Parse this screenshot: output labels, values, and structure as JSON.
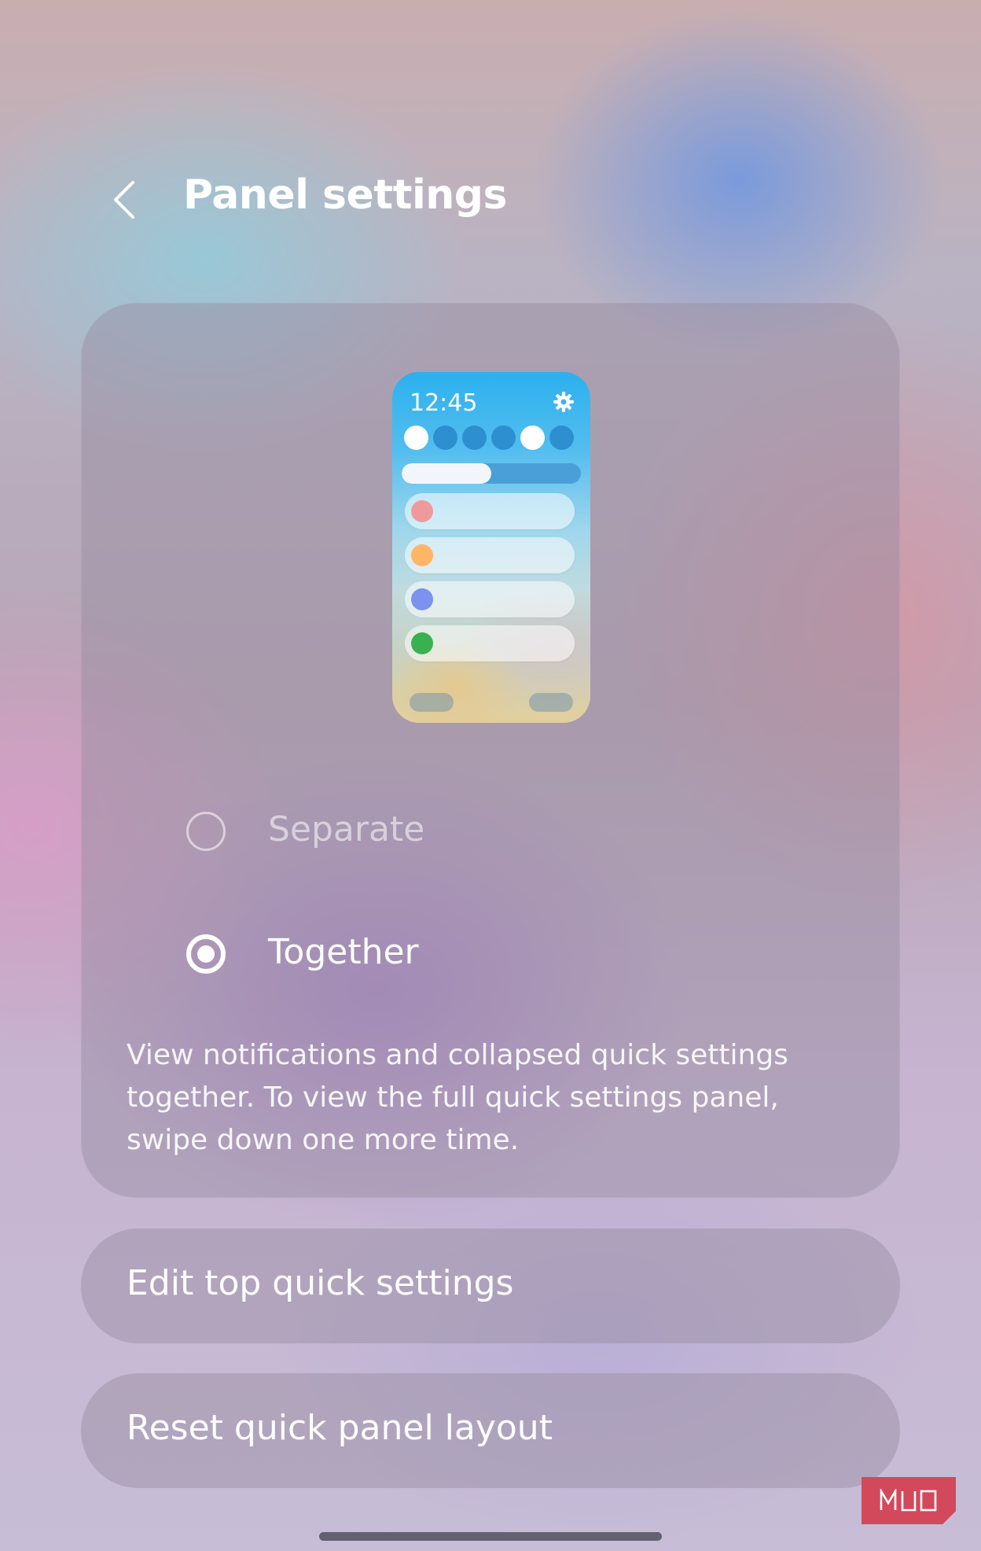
{
  "header": {
    "title": "Panel settings"
  },
  "preview": {
    "time": "12:45",
    "quick_toggles": [
      true,
      false,
      false,
      false,
      true,
      false
    ],
    "brightness_level": 0.5,
    "notification_dot_colors": [
      "#ef9a9a",
      "#ffb565",
      "#7b92ee",
      "#3ab14f"
    ]
  },
  "options": {
    "separate": {
      "label": "Separate",
      "selected": false
    },
    "together": {
      "label": "Together",
      "selected": true
    }
  },
  "description": "View notifications and collapsed quick settings together. To view the full quick settings panel, swipe down one more time.",
  "buttons": {
    "edit_label": "Edit top quick settings",
    "reset_label": "Reset quick panel layout"
  },
  "watermark": {
    "text": "MUO",
    "color": "#d2495b"
  }
}
